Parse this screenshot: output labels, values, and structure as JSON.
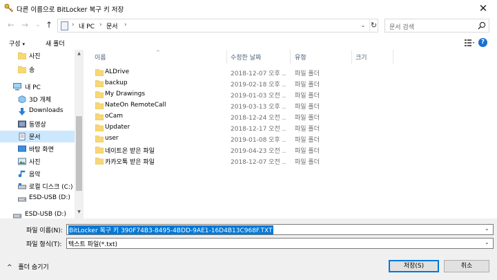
{
  "window": {
    "title": "다른 이름으로 BitLocker 복구 키 저장",
    "close_glyph": "✕"
  },
  "nav": {
    "back_glyph": "←",
    "forward_glyph": "→",
    "recent_glyph": "⌄",
    "up_glyph": "↑",
    "breadcrumb": [
      "내 PC",
      "문서"
    ],
    "crumb_sep": "›",
    "dropdown_glyph": "⌄",
    "refresh_glyph": "↻",
    "search_placeholder": "문서 검색"
  },
  "toolbar": {
    "organize_label": "구성",
    "organize_arrow": "▾",
    "new_folder_label": "새 폴더",
    "help_glyph": "?"
  },
  "sidebar": {
    "items": [
      {
        "label": "사진",
        "icon": "folder-icon"
      },
      {
        "label": "송",
        "icon": "folder-icon"
      },
      {
        "label": "내 PC",
        "icon": "pc-icon"
      },
      {
        "label": "3D 개체",
        "icon": "3d-objects-icon"
      },
      {
        "label": "Downloads",
        "icon": "download-icon"
      },
      {
        "label": "동영상",
        "icon": "video-icon"
      },
      {
        "label": "문서",
        "icon": "documents-icon"
      },
      {
        "label": "바탕 화면",
        "icon": "desktop-icon"
      },
      {
        "label": "사진",
        "icon": "pictures-icon"
      },
      {
        "label": "음악",
        "icon": "music-icon"
      },
      {
        "label": "로컬 디스크 (C:)",
        "icon": "drive-icon"
      },
      {
        "label": "ESD-USB (D:)",
        "icon": "usb-drive-icon"
      },
      {
        "label": "ESD-USB (D:)",
        "icon": "usb-drive-icon"
      }
    ],
    "scroll_up": "▲",
    "scroll_down": "▼"
  },
  "filelist": {
    "columns": [
      "이름",
      "수정한 날짜",
      "유형",
      "크기"
    ],
    "sort_glyph": "^",
    "rows": [
      {
        "name": "ALDrive",
        "date": "2018-12-07 오후 ...",
        "type": "파일 폴더"
      },
      {
        "name": "backup",
        "date": "2019-02-18 오후 ...",
        "type": "파일 폴더"
      },
      {
        "name": "My Drawings",
        "date": "2019-01-03 오전 ...",
        "type": "파일 폴더"
      },
      {
        "name": "NateOn RemoteCall",
        "date": "2019-03-13 오후 ...",
        "type": "파일 폴더"
      },
      {
        "name": "oCam",
        "date": "2018-12-24 오전 ...",
        "type": "파일 폴더"
      },
      {
        "name": "Updater",
        "date": "2018-12-17 오전 ...",
        "type": "파일 폴더"
      },
      {
        "name": "user",
        "date": "2019-01-08 오후 ...",
        "type": "파일 폴더"
      },
      {
        "name": "네이트온 받은 파일",
        "date": "2019-04-23 오전 ...",
        "type": "파일 폴더"
      },
      {
        "name": "카카오톡 받은 파일",
        "date": "2018-12-07 오전 ...",
        "type": "파일 폴더"
      }
    ]
  },
  "bottom": {
    "filename_label": "파일 이름(N):",
    "filename_value": "BitLocker 복구 키 390F74B3-8495-4BDD-9AE1-16D4B13C968F.TXT",
    "filetype_label": "파일 형식(T):",
    "filetype_value": "텍스트 파일(*.txt)",
    "hide_folders_label": "폴더 숨기기",
    "hide_folders_glyph": "^",
    "dropdown_glyph": "⌄",
    "save_label": "저장(S)",
    "cancel_label": "취소"
  },
  "colors": {
    "accent": "#0078d7",
    "selected_bg": "#cce8ff",
    "folder": "#f8d775"
  }
}
